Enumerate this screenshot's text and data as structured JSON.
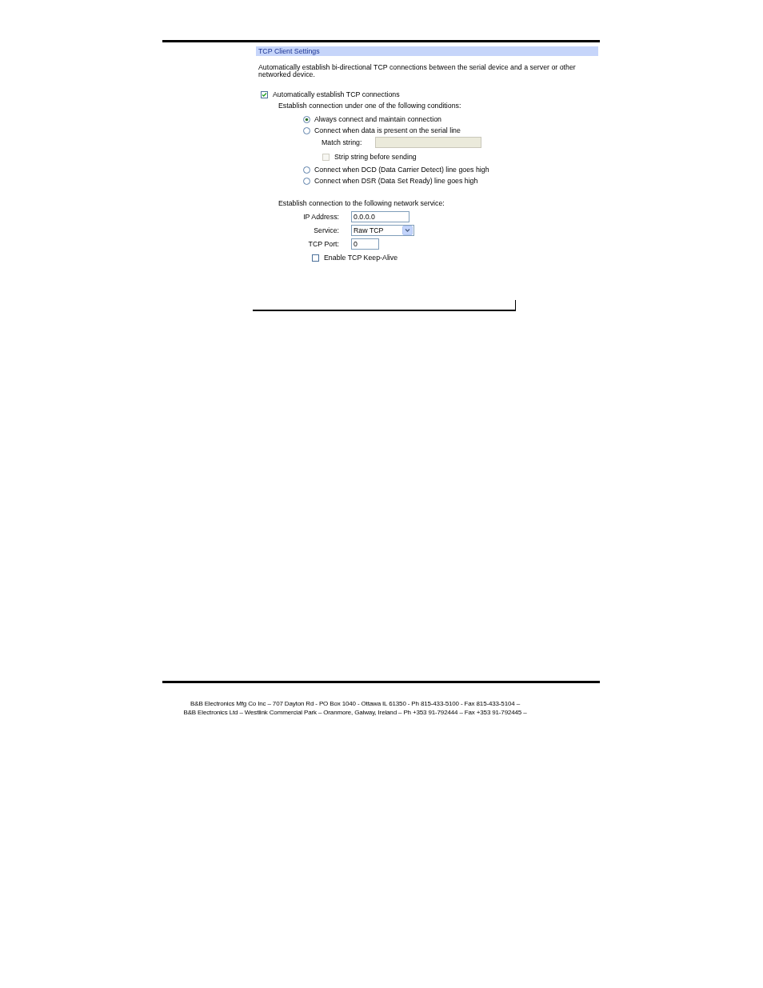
{
  "panel": {
    "title": "TCP Client Settings",
    "description": "Automatically establish bi-directional TCP connections between the serial device and a server or other networked device."
  },
  "auto_connect": {
    "label": "Automatically establish TCP connections",
    "checked": true
  },
  "conditions": {
    "heading": "Establish connection under one of the following conditions:",
    "options": [
      {
        "label": "Always connect and maintain connection",
        "selected": true
      },
      {
        "label": "Connect when data is present on the serial line",
        "selected": false,
        "details": {
          "match_string": {
            "label": "Match string:",
            "disabled": true
          },
          "strip_string": {
            "label": "Strip string before sending",
            "checked": false,
            "disabled": true
          }
        }
      },
      {
        "label": "Connect when DCD (Data Carrier Detect) line goes high",
        "selected": false
      },
      {
        "label": "Connect when DSR (Data Set Ready) line goes high",
        "selected": false
      }
    ]
  },
  "network_service": {
    "heading": "Establish connection to the following network service:",
    "fields": [
      {
        "kind": "text",
        "label": "IP Address:",
        "value": "0.0.0.0"
      },
      {
        "kind": "select",
        "label": "Service:",
        "value": "Raw TCP"
      },
      {
        "kind": "text",
        "label": "TCP Port:",
        "value": "0"
      }
    ],
    "keep_alive": {
      "label": "Enable TCP Keep-Alive",
      "checked": false
    }
  },
  "footer": {
    "lines": [
      "B&B Electronics Mfg Co Inc – 707 Dayton Rd - PO Box 1040 - Ottawa IL 61350 - Ph 815-433-5100 - Fax 815-433-5104 –",
      "B&B Electronics Ltd – Westlink Commercial Park – Oranmore, Galway, Ireland – Ph +353 91-792444 – Fax +353 91-792445 –"
    ]
  }
}
